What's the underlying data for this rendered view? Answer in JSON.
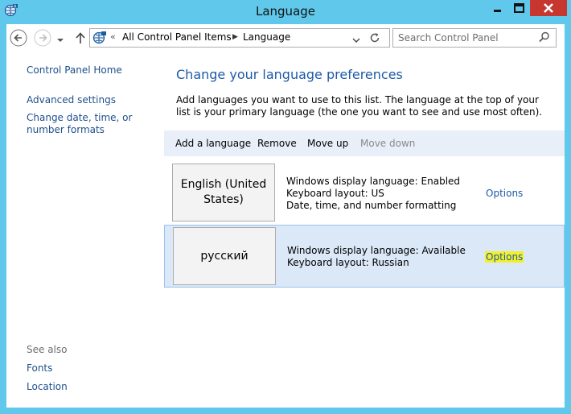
{
  "window": {
    "title": "Language",
    "app_icon": "control-panel-globe-icon",
    "close_color": "#c7372f",
    "titlebar_color": "#5fc8eb"
  },
  "navigation": {
    "address_overflow": "«",
    "breadcrumbs": [
      "All Control Panel Items",
      "Language"
    ],
    "search_placeholder": "Search Control Panel"
  },
  "sidebar": {
    "home": "Control Panel Home",
    "links": [
      "Advanced settings",
      "Change date, time, or number formats"
    ],
    "see_also_label": "See also",
    "see_also_links": [
      "Fonts",
      "Location"
    ]
  },
  "main": {
    "heading": "Change your language preferences",
    "description": "Add languages you want to use to this list. The language at the top of your list is your primary language (the one you want to see and use most often).",
    "toolbar": {
      "add": "Add a language",
      "remove": "Remove",
      "move_up": "Move up",
      "move_down": "Move down"
    },
    "languages": [
      {
        "name": "English (United States)",
        "details": [
          "Windows display language: Enabled",
          "Keyboard layout: US",
          "Date, time, and number formatting"
        ],
        "options": "Options",
        "selected": false
      },
      {
        "name": "русский",
        "details": [
          "Windows display language: Available",
          "Keyboard layout: Russian"
        ],
        "options": "Options",
        "selected": true,
        "options_highlight": "#f2f02a"
      }
    ]
  }
}
